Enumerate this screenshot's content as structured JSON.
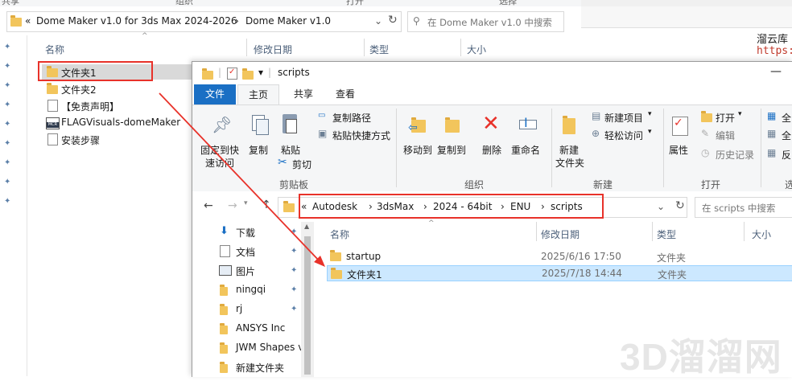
{
  "back_window": {
    "top_fragments": [
      "共享",
      "组织",
      "打开",
      "选择"
    ],
    "breadcrumb": [
      "«",
      "Dome Maker v1.0 for 3ds Max 2024-2026",
      "Dome Maker v1.0"
    ],
    "search_placeholder": "在 Dome Maker v1.0 中搜索",
    "columns": [
      "名称",
      "修改日期",
      "类型",
      "大小"
    ],
    "files": [
      "文件夹1",
      "文件夹2",
      "【免责声明】",
      "FLAGVisuals-domeMaker",
      "安装步骤"
    ],
    "file_icon_mcr": "MCR"
  },
  "bg_right": {
    "text1": "溜云库",
    "text2": "https:"
  },
  "front_window": {
    "title": "scripts",
    "qat_dropdown": "▾",
    "tabs": [
      "文件",
      "主页",
      "共享",
      "查看"
    ],
    "ribbon": {
      "pin_quick_access": "固定到快速访问",
      "pin_line1": "固定到快",
      "pin_line2": "速访问",
      "copy": "复制",
      "paste": "粘贴",
      "copy_path": "复制路径",
      "paste_shortcut": "粘贴快捷方式",
      "cut": "剪切",
      "group_clipboard": "剪贴板",
      "move_to": "移动到",
      "copy_to": "复制到",
      "delete": "删除",
      "rename": "重命名",
      "group_organize": "组织",
      "new_folder_l1": "新建",
      "new_folder_l2": "文件夹",
      "new_item": "新建项目",
      "easy_access": "轻松访问",
      "group_new": "新建",
      "properties": "属性",
      "open": "打开",
      "edit": "编辑",
      "history": "历史记录",
      "group_open": "打开",
      "select_all_frag": "全",
      "select_none_frag": "全",
      "invert_frag": "反",
      "group_select_frag": "选"
    },
    "nav": {
      "back": "←",
      "forward": "→",
      "up": "↑"
    },
    "breadcrumb": [
      "«",
      "Autodesk",
      "3dsMax",
      "2024 - 64bit",
      "ENU",
      "scripts"
    ],
    "search_placeholder": "在 scripts 中搜索",
    "sidebar": [
      "下载",
      "文档",
      "图片",
      "ningqi",
      "rj",
      "ANSYS Inc",
      "JWM Shapes v",
      "新建文件夹"
    ],
    "columns": [
      "名称",
      "修改日期",
      "类型",
      "大小"
    ],
    "rows": [
      {
        "name": "startup",
        "date": "2025/6/16 17:50",
        "type": "文件夹"
      },
      {
        "name": "文件夹1",
        "date": "2025/7/18 14:44",
        "type": "文件夹"
      }
    ]
  },
  "watermark": "3D溜溜网",
  "colors": {
    "accent": "#1a6fc4",
    "highlight": "#cce8ff",
    "red_annotation": "#e8322a",
    "folder": "#f2c55c"
  }
}
